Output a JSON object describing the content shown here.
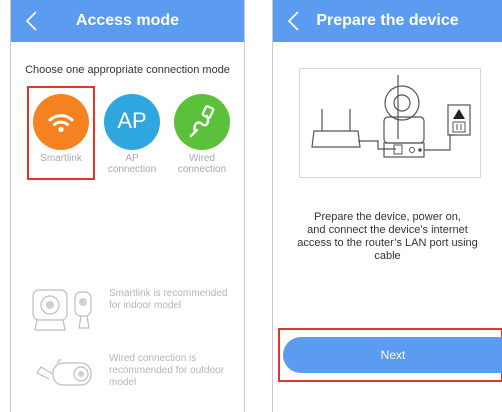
{
  "left_screen": {
    "title": "Access mode",
    "instruction": "Choose one appropriate connection mode",
    "modes": [
      {
        "label": "Smartlink",
        "icon": "wifi-icon",
        "color": "#f58220"
      },
      {
        "label": "AP",
        "label2": "connection",
        "icon_text": "AP",
        "color": "#2ea7e0"
      },
      {
        "label": "Wired",
        "label2": "connection",
        "icon": "cable-icon",
        "color": "#5cc13a"
      }
    ],
    "recommendations": [
      {
        "line1": "Smartlink is recommended",
        "line2": "for indoor model"
      },
      {
        "line1": "Wired connection is",
        "line2": "recommended for outdoor",
        "line3": "model"
      }
    ]
  },
  "right_screen": {
    "title": "Prepare the device",
    "instruction_lines": [
      "Prepare the device, power on,",
      "and connect the device’s internet",
      "access to the router’s LAN port using",
      "cable"
    ],
    "next_label": "Next"
  },
  "colors": {
    "nav": "#5b9bf0",
    "highlight": "#e4352c"
  }
}
